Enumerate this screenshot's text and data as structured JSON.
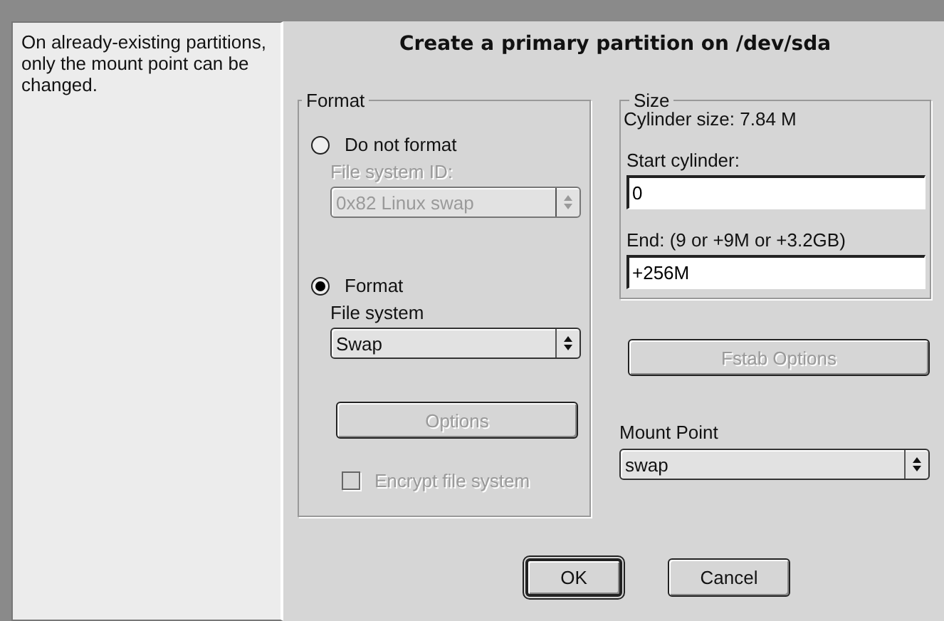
{
  "help_panel": {
    "text": "On already-existing partitions, only the mount point can be changed."
  },
  "dialog": {
    "title": "Create a primary partition on /dev/sda"
  },
  "format_group": {
    "legend": "Format",
    "options": [
      {
        "kind": "radio",
        "label": "Do not format",
        "selected": false
      },
      {
        "kind": "label",
        "label": "File system ID:",
        "disabled": true
      },
      {
        "kind": "select",
        "value": "0x82 Linux swap",
        "disabled": true
      },
      {
        "kind": "radio",
        "label": "Format",
        "selected": true
      },
      {
        "kind": "label",
        "label": "File system",
        "disabled": false
      },
      {
        "kind": "select",
        "value": "Swap",
        "disabled": false
      },
      {
        "kind": "button",
        "label": "Options",
        "disabled": true
      },
      {
        "kind": "checkbox",
        "label": "Encrypt file system",
        "checked": false,
        "disabled": true
      }
    ]
  },
  "size_group": {
    "legend": "Size",
    "cylinder_size": "Cylinder size: 7.84 M",
    "fields": [
      {
        "label": "Start cylinder:",
        "value": "0"
      },
      {
        "label": "End:  (9 or +9M or +3.2GB)",
        "value": "+256M"
      }
    ]
  },
  "fstab_button": {
    "label": "Fstab Options",
    "disabled": true
  },
  "mount_point": {
    "label": "Mount Point",
    "value": "swap"
  },
  "buttons": [
    {
      "label": "OK",
      "default": true
    },
    {
      "label": "Cancel",
      "default": false
    }
  ]
}
